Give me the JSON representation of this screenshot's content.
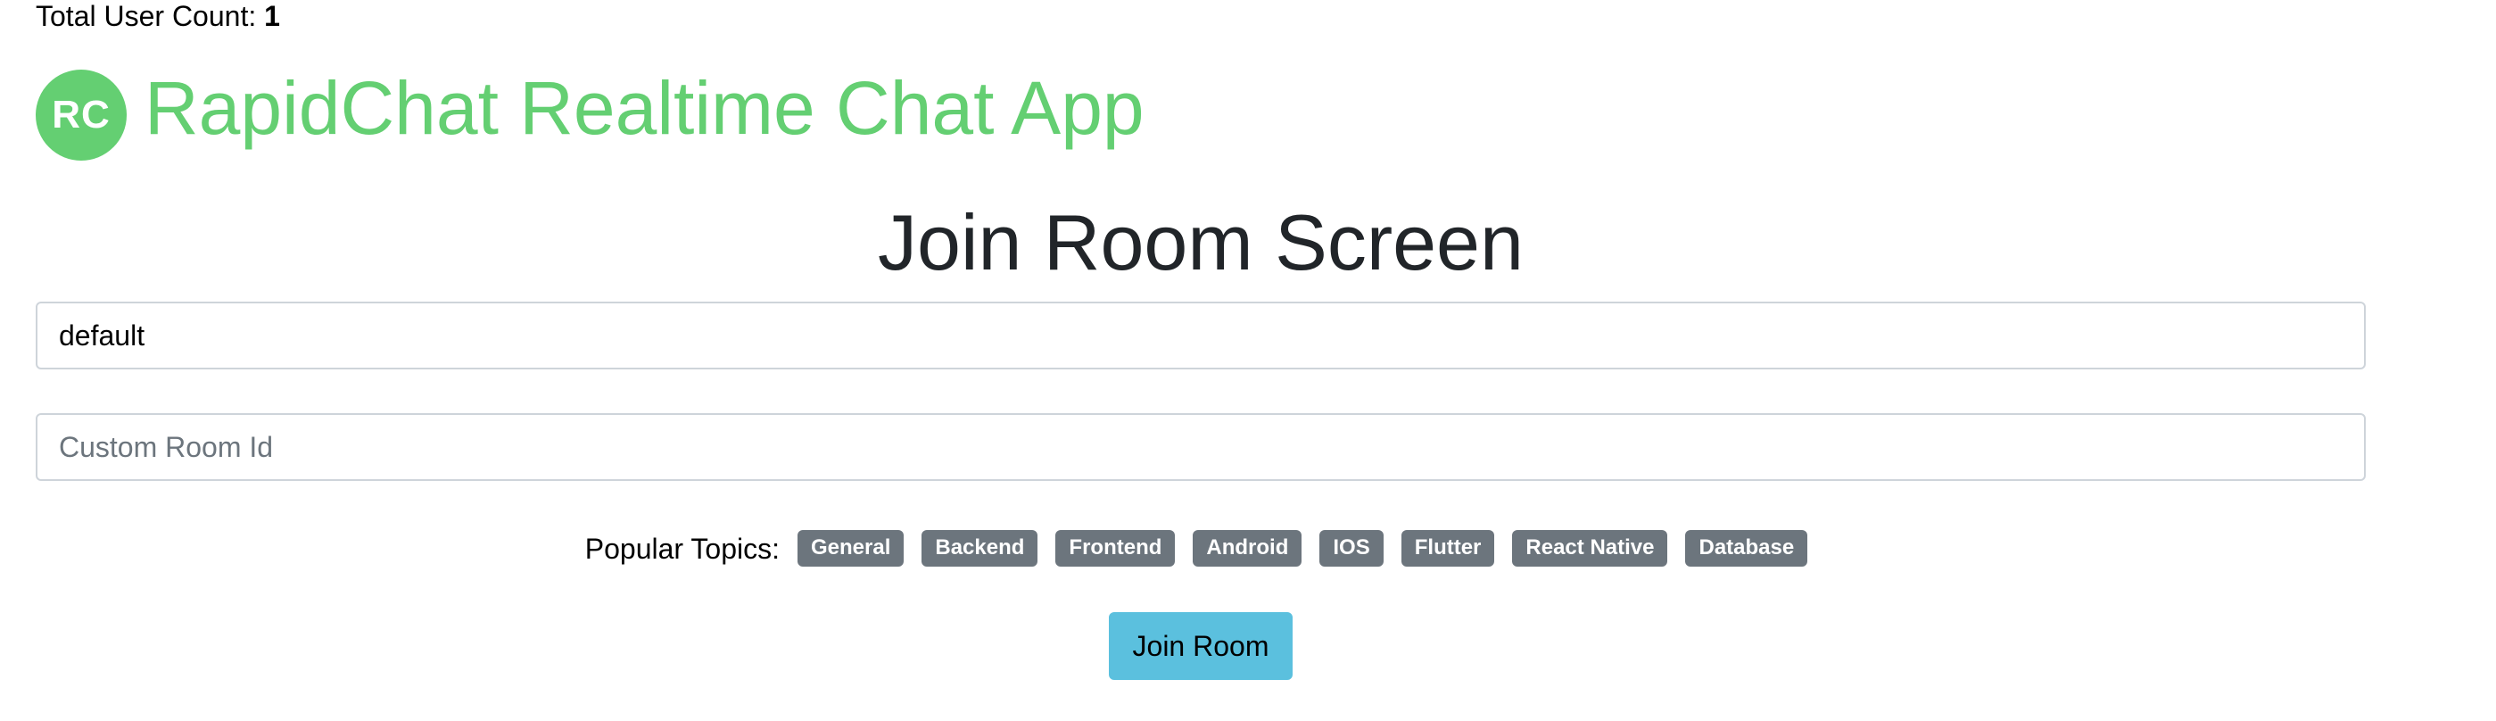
{
  "header": {
    "user_count_label": "Total User Count:",
    "user_count_value": "1"
  },
  "brand": {
    "logo_text": "RC",
    "title": "RapidChat Realtime Chat App",
    "color": "#64cf72"
  },
  "main": {
    "title": "Join Room Screen",
    "room_field": {
      "value": "default"
    },
    "custom_room_field": {
      "value": "",
      "placeholder": "Custom Room Id"
    },
    "topics": {
      "label": "Popular Topics:",
      "items": [
        "General",
        "Backend",
        "Frontend",
        "Android",
        "IOS",
        "Flutter",
        "React Native",
        "Database"
      ]
    },
    "join_button": {
      "label": "Join Room",
      "color": "#5bc0de"
    }
  }
}
